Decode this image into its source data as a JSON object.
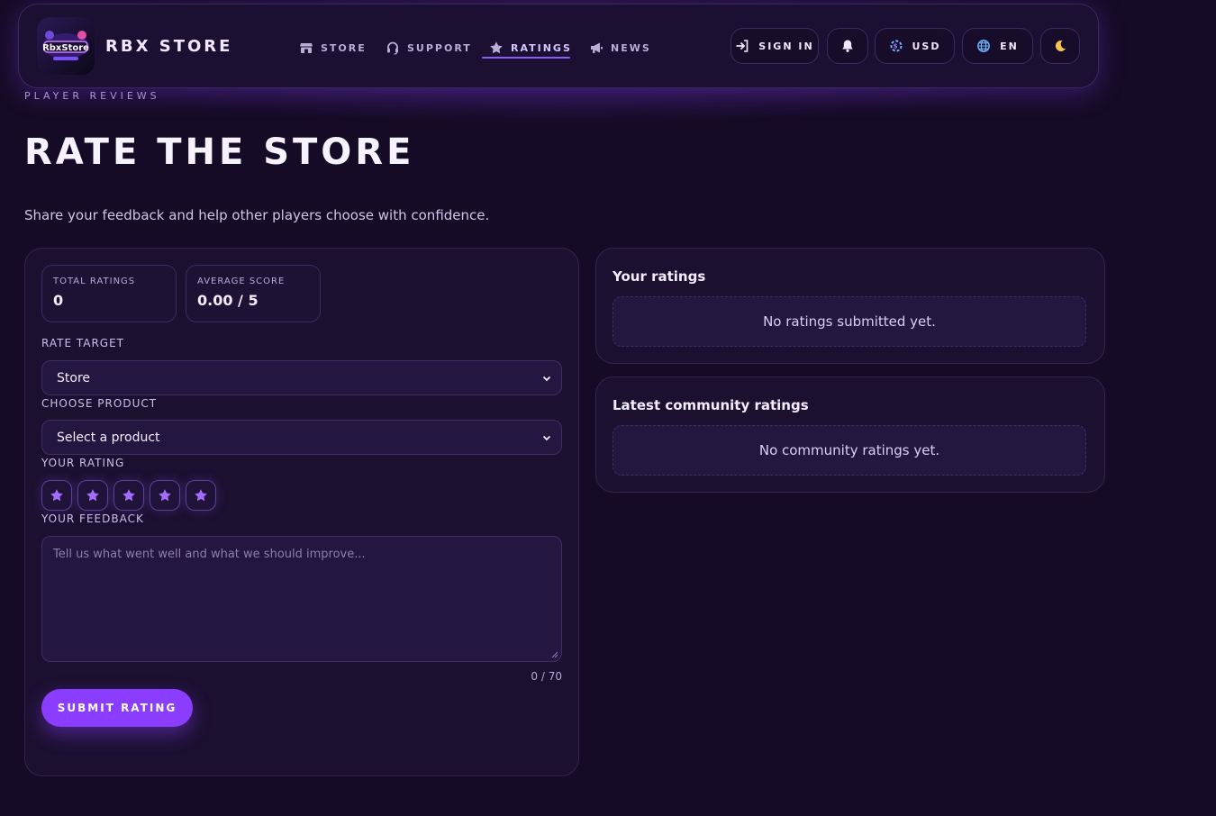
{
  "header": {
    "logo_text": "RbxStore",
    "brand": "RBX STORE",
    "nav": [
      {
        "label": "STORE",
        "icon": "store-icon"
      },
      {
        "label": "SUPPORT",
        "icon": "headset-icon"
      },
      {
        "label": "RATINGS",
        "icon": "star-icon",
        "active": true
      },
      {
        "label": "NEWS",
        "icon": "megaphone-icon"
      }
    ],
    "sign_in": "SIGN IN",
    "currency": "USD",
    "language": "EN"
  },
  "page": {
    "eyebrow": "PLAYER REVIEWS",
    "title": "RATE THE STORE",
    "subtitle": "Share your feedback and help other players choose with confidence."
  },
  "form": {
    "stats": [
      {
        "label": "TOTAL RATINGS",
        "value": "0"
      },
      {
        "label": "AVERAGE SCORE",
        "value": "0.00 / 5"
      }
    ],
    "rate_target_label": "RATE TARGET",
    "rate_target_value": "Store",
    "product_label": "CHOOSE PRODUCT",
    "product_value": "Select a product",
    "rating_label": "YOUR RATING",
    "star_count": 5,
    "feedback_label": "YOUR FEEDBACK",
    "feedback_placeholder": "Tell us what went well and what we should improve...",
    "counter": "0 / 70",
    "submit_label": "SUBMIT RATING"
  },
  "your_ratings": {
    "title": "Your ratings",
    "empty": "No ratings submitted yet."
  },
  "community": {
    "title": "Latest community ratings",
    "empty": "No community ratings yet."
  },
  "colors": {
    "background": "#150b26",
    "accent": "#8b3dff",
    "star": "#a56bff"
  }
}
